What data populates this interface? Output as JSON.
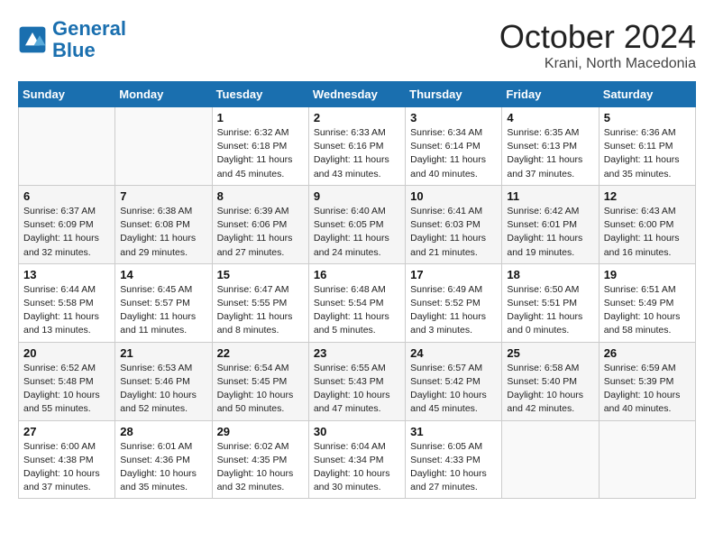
{
  "header": {
    "logo_line1": "General",
    "logo_line2": "Blue",
    "month": "October 2024",
    "location": "Krani, North Macedonia"
  },
  "weekdays": [
    "Sunday",
    "Monday",
    "Tuesday",
    "Wednesday",
    "Thursday",
    "Friday",
    "Saturday"
  ],
  "weeks": [
    [
      {
        "day": "",
        "info": ""
      },
      {
        "day": "",
        "info": ""
      },
      {
        "day": "1",
        "info": "Sunrise: 6:32 AM\nSunset: 6:18 PM\nDaylight: 11 hours and 45 minutes."
      },
      {
        "day": "2",
        "info": "Sunrise: 6:33 AM\nSunset: 6:16 PM\nDaylight: 11 hours and 43 minutes."
      },
      {
        "day": "3",
        "info": "Sunrise: 6:34 AM\nSunset: 6:14 PM\nDaylight: 11 hours and 40 minutes."
      },
      {
        "day": "4",
        "info": "Sunrise: 6:35 AM\nSunset: 6:13 PM\nDaylight: 11 hours and 37 minutes."
      },
      {
        "day": "5",
        "info": "Sunrise: 6:36 AM\nSunset: 6:11 PM\nDaylight: 11 hours and 35 minutes."
      }
    ],
    [
      {
        "day": "6",
        "info": "Sunrise: 6:37 AM\nSunset: 6:09 PM\nDaylight: 11 hours and 32 minutes."
      },
      {
        "day": "7",
        "info": "Sunrise: 6:38 AM\nSunset: 6:08 PM\nDaylight: 11 hours and 29 minutes."
      },
      {
        "day": "8",
        "info": "Sunrise: 6:39 AM\nSunset: 6:06 PM\nDaylight: 11 hours and 27 minutes."
      },
      {
        "day": "9",
        "info": "Sunrise: 6:40 AM\nSunset: 6:05 PM\nDaylight: 11 hours and 24 minutes."
      },
      {
        "day": "10",
        "info": "Sunrise: 6:41 AM\nSunset: 6:03 PM\nDaylight: 11 hours and 21 minutes."
      },
      {
        "day": "11",
        "info": "Sunrise: 6:42 AM\nSunset: 6:01 PM\nDaylight: 11 hours and 19 minutes."
      },
      {
        "day": "12",
        "info": "Sunrise: 6:43 AM\nSunset: 6:00 PM\nDaylight: 11 hours and 16 minutes."
      }
    ],
    [
      {
        "day": "13",
        "info": "Sunrise: 6:44 AM\nSunset: 5:58 PM\nDaylight: 11 hours and 13 minutes."
      },
      {
        "day": "14",
        "info": "Sunrise: 6:45 AM\nSunset: 5:57 PM\nDaylight: 11 hours and 11 minutes."
      },
      {
        "day": "15",
        "info": "Sunrise: 6:47 AM\nSunset: 5:55 PM\nDaylight: 11 hours and 8 minutes."
      },
      {
        "day": "16",
        "info": "Sunrise: 6:48 AM\nSunset: 5:54 PM\nDaylight: 11 hours and 5 minutes."
      },
      {
        "day": "17",
        "info": "Sunrise: 6:49 AM\nSunset: 5:52 PM\nDaylight: 11 hours and 3 minutes."
      },
      {
        "day": "18",
        "info": "Sunrise: 6:50 AM\nSunset: 5:51 PM\nDaylight: 11 hours and 0 minutes."
      },
      {
        "day": "19",
        "info": "Sunrise: 6:51 AM\nSunset: 5:49 PM\nDaylight: 10 hours and 58 minutes."
      }
    ],
    [
      {
        "day": "20",
        "info": "Sunrise: 6:52 AM\nSunset: 5:48 PM\nDaylight: 10 hours and 55 minutes."
      },
      {
        "day": "21",
        "info": "Sunrise: 6:53 AM\nSunset: 5:46 PM\nDaylight: 10 hours and 52 minutes."
      },
      {
        "day": "22",
        "info": "Sunrise: 6:54 AM\nSunset: 5:45 PM\nDaylight: 10 hours and 50 minutes."
      },
      {
        "day": "23",
        "info": "Sunrise: 6:55 AM\nSunset: 5:43 PM\nDaylight: 10 hours and 47 minutes."
      },
      {
        "day": "24",
        "info": "Sunrise: 6:57 AM\nSunset: 5:42 PM\nDaylight: 10 hours and 45 minutes."
      },
      {
        "day": "25",
        "info": "Sunrise: 6:58 AM\nSunset: 5:40 PM\nDaylight: 10 hours and 42 minutes."
      },
      {
        "day": "26",
        "info": "Sunrise: 6:59 AM\nSunset: 5:39 PM\nDaylight: 10 hours and 40 minutes."
      }
    ],
    [
      {
        "day": "27",
        "info": "Sunrise: 6:00 AM\nSunset: 4:38 PM\nDaylight: 10 hours and 37 minutes."
      },
      {
        "day": "28",
        "info": "Sunrise: 6:01 AM\nSunset: 4:36 PM\nDaylight: 10 hours and 35 minutes."
      },
      {
        "day": "29",
        "info": "Sunrise: 6:02 AM\nSunset: 4:35 PM\nDaylight: 10 hours and 32 minutes."
      },
      {
        "day": "30",
        "info": "Sunrise: 6:04 AM\nSunset: 4:34 PM\nDaylight: 10 hours and 30 minutes."
      },
      {
        "day": "31",
        "info": "Sunrise: 6:05 AM\nSunset: 4:33 PM\nDaylight: 10 hours and 27 minutes."
      },
      {
        "day": "",
        "info": ""
      },
      {
        "day": "",
        "info": ""
      }
    ]
  ]
}
